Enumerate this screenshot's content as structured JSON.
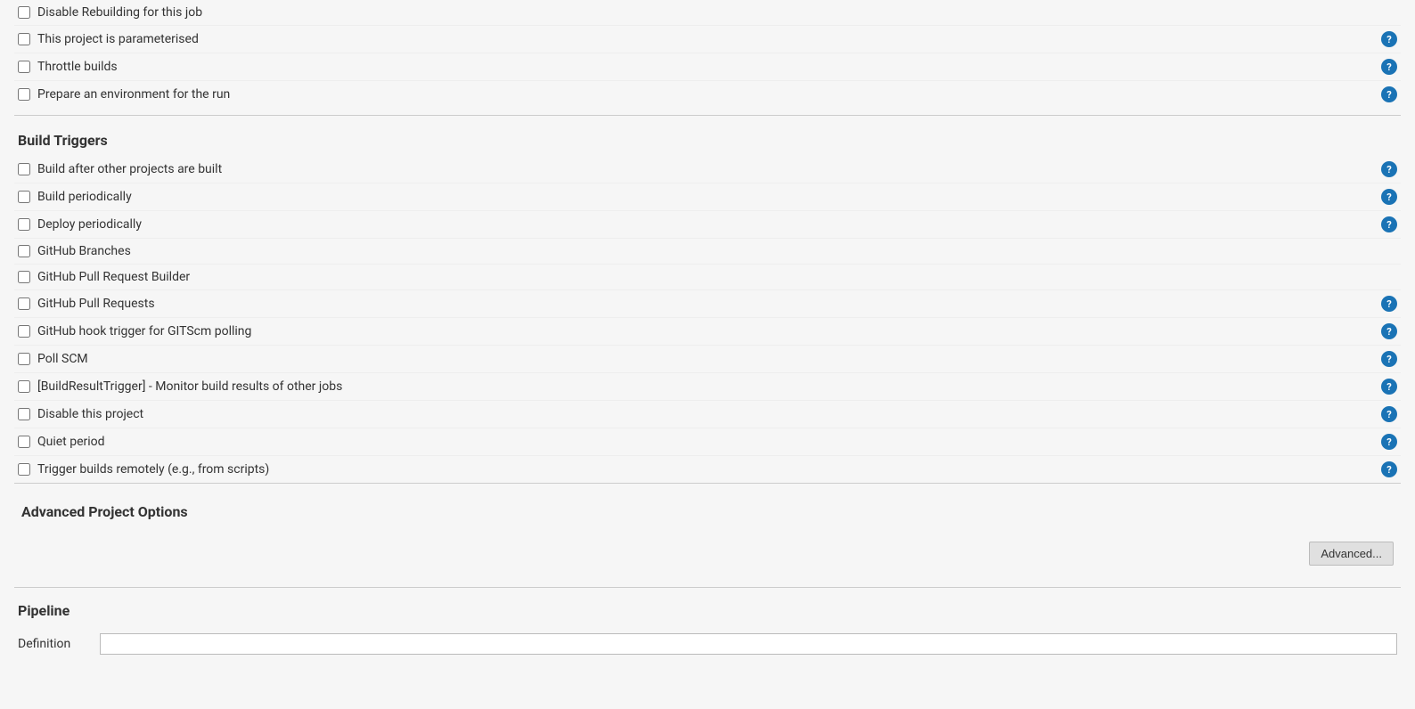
{
  "top_section": {
    "items": [
      {
        "id": "disable-rebuilding",
        "label": "Disable Rebuilding for this job",
        "checked": false,
        "has_help": false
      },
      {
        "id": "parameterised",
        "label": "This project is parameterised",
        "checked": false,
        "has_help": true
      },
      {
        "id": "throttle-builds",
        "label": "Throttle builds",
        "checked": false,
        "has_help": true
      },
      {
        "id": "prepare-environment",
        "label": "Prepare an environment for the run",
        "checked": false,
        "has_help": true
      }
    ]
  },
  "build_triggers": {
    "section_title": "Build Triggers",
    "items": [
      {
        "id": "build-after-other",
        "label": "Build after other projects are built",
        "checked": false,
        "has_help": true
      },
      {
        "id": "build-periodically",
        "label": "Build periodically",
        "checked": false,
        "has_help": true
      },
      {
        "id": "deploy-periodically",
        "label": "Deploy periodically",
        "checked": false,
        "has_help": true
      },
      {
        "id": "github-branches",
        "label": "GitHub Branches",
        "checked": false,
        "has_help": false
      },
      {
        "id": "github-pull-request-builder",
        "label": "GitHub Pull Request Builder",
        "checked": false,
        "has_help": false
      },
      {
        "id": "github-pull-requests",
        "label": "GitHub Pull Requests",
        "checked": false,
        "has_help": true
      },
      {
        "id": "github-hook-trigger",
        "label": "GitHub hook trigger for GITScm polling",
        "checked": false,
        "has_help": true
      },
      {
        "id": "poll-scm",
        "label": "Poll SCM",
        "checked": false,
        "has_help": true
      },
      {
        "id": "build-result-trigger",
        "label": "[BuildResultTrigger] - Monitor build results of other jobs",
        "checked": false,
        "has_help": true
      },
      {
        "id": "disable-this-project",
        "label": "Disable this project",
        "checked": false,
        "has_help": true
      },
      {
        "id": "quiet-period",
        "label": "Quiet period",
        "checked": false,
        "has_help": true
      },
      {
        "id": "trigger-builds-remotely",
        "label": "Trigger builds remotely (e.g., from scripts)",
        "checked": false,
        "has_help": true
      }
    ]
  },
  "advanced_project_options": {
    "section_title": "Advanced Project Options",
    "advanced_button_label": "Advanced..."
  },
  "pipeline": {
    "section_title": "Pipeline",
    "definition_label": "Definition",
    "definition_placeholder": ""
  },
  "help_icon_label": "?"
}
